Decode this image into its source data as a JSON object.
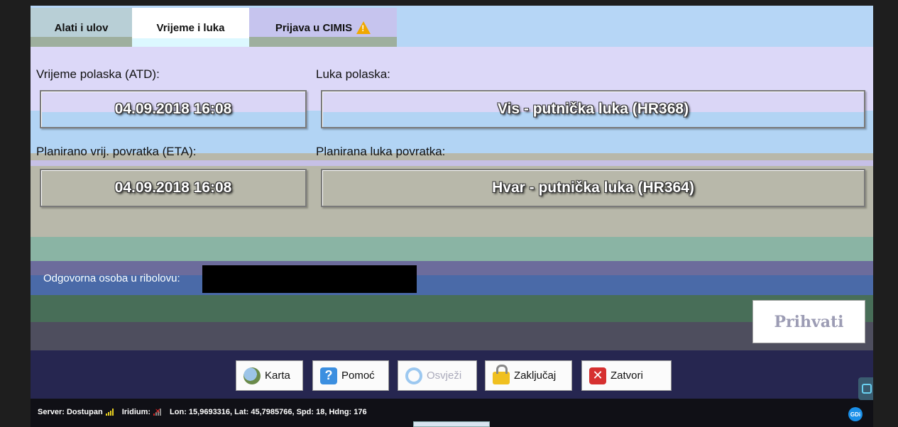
{
  "tabs": [
    {
      "label": "Alati i ulov"
    },
    {
      "label": "Vrijeme i luka"
    },
    {
      "label": "Prijava u CIMIS"
    }
  ],
  "departure": {
    "time_label": "Vrijeme polaska (ATD):",
    "time_value": "04.09.2018 16:08",
    "port_label": "Luka polaska:",
    "port_value": "Vis - putnička luka (HR368)"
  },
  "return": {
    "time_label": "Planirano vrij. povratka (ETA):",
    "time_value": "04.09.2018 16:08",
    "port_label": "Planirana luka povratka:",
    "port_value": "Hvar - putnička luka (HR364)"
  },
  "responsible": {
    "label": "Odgovorna osoba u ribolovu:"
  },
  "accept_label": "Prihvati",
  "toolbar": {
    "map": "Karta",
    "help": "Pomoć",
    "refresh": "Osvježi",
    "lock": "Zaključaj",
    "close": "Zatvori"
  },
  "status": {
    "server": "Server: Dostupan",
    "iridium": "Iridium:",
    "position": "Lon: 15,9693316, Lat: 45,7985766, Spd: 18, Hdng: 176"
  },
  "icons": {
    "gdi": "GDi"
  },
  "colors": {
    "accent_dark": "#262650",
    "status_bar": "#101016",
    "warning": "#f0a800"
  }
}
